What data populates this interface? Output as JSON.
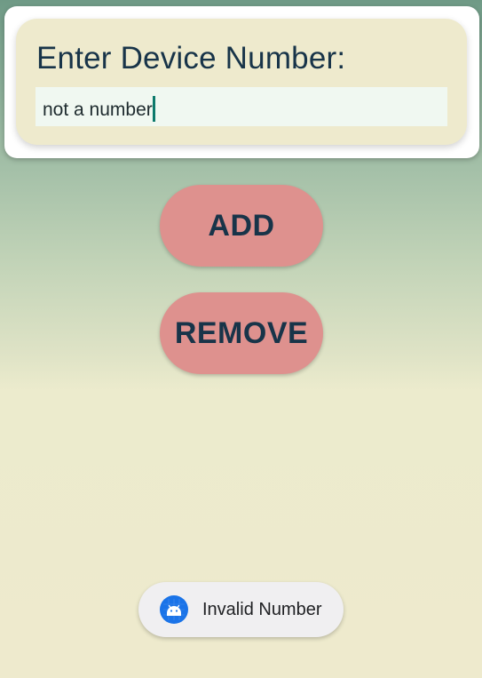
{
  "form": {
    "prompt": "Enter Device Number:",
    "input_value": "not a number"
  },
  "buttons": {
    "add_label": "ADD",
    "remove_label": "REMOVE"
  },
  "toast": {
    "message": "Invalid Number",
    "icon": "android-robot-icon"
  },
  "colors": {
    "button_fill": "#de918e",
    "text_dark": "#183449",
    "card_fill": "#eeeacd",
    "input_fill": "#f0f8f1",
    "caret": "#0d7a6c",
    "toast_icon_bg": "#1a73e8"
  }
}
